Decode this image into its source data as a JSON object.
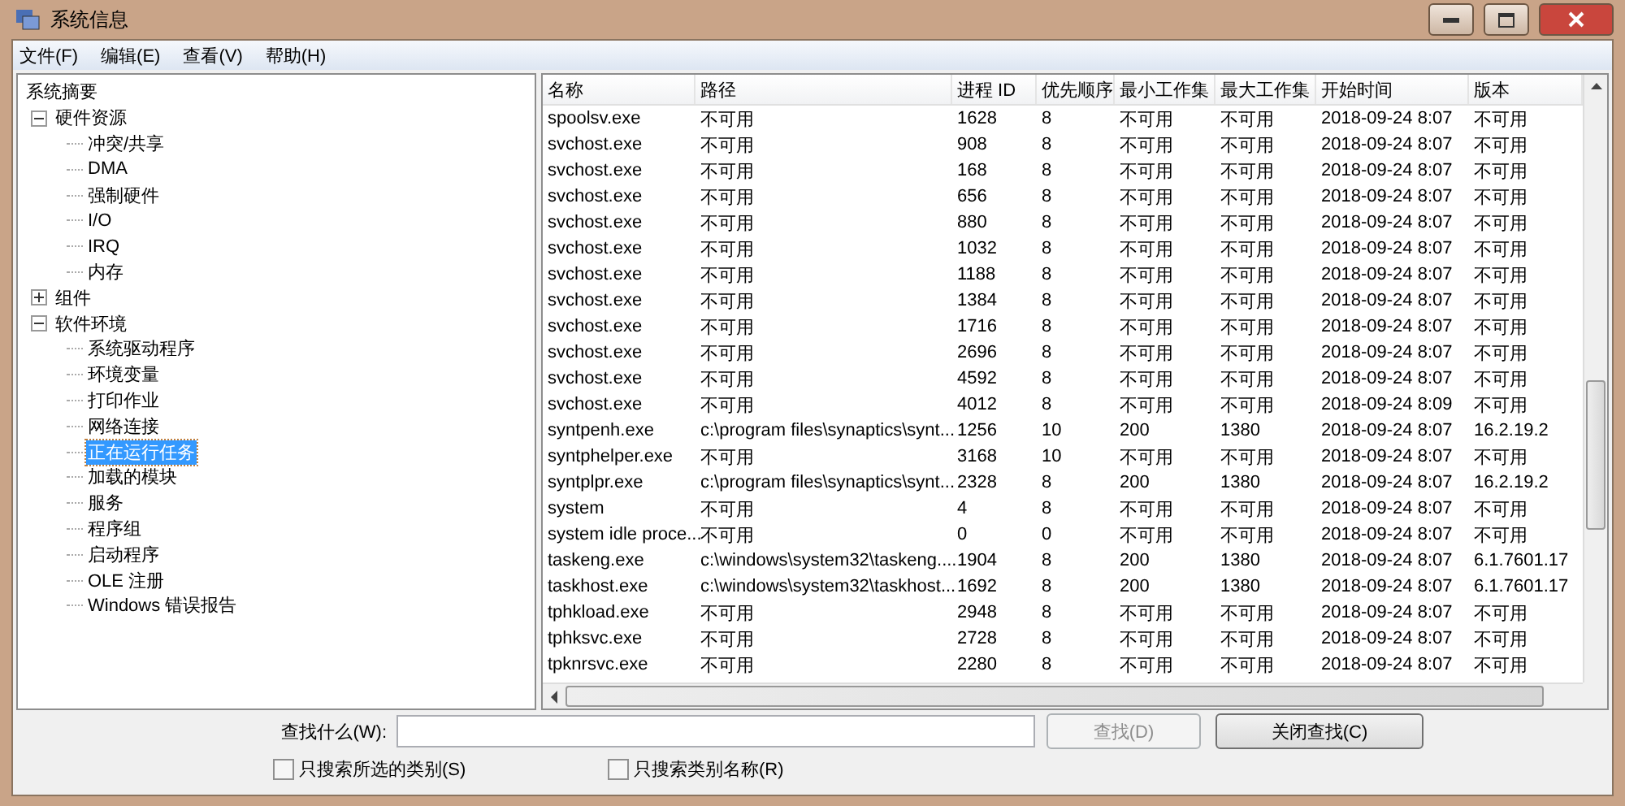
{
  "window": {
    "title": "系统信息"
  },
  "menu": [
    "文件(F)",
    "编辑(E)",
    "查看(V)",
    "帮助(H)"
  ],
  "tree": [
    {
      "label": "系统摘要",
      "selected": false,
      "children": [
        {
          "label": "硬件资源",
          "selected": false,
          "expanded": true,
          "children": [
            {
              "label": "冲突/共享",
              "selected": false
            },
            {
              "label": "DMA",
              "selected": false
            },
            {
              "label": "强制硬件",
              "selected": false
            },
            {
              "label": "I/O",
              "selected": false
            },
            {
              "label": "IRQ",
              "selected": false
            },
            {
              "label": "内存",
              "selected": false
            }
          ]
        },
        {
          "label": "组件",
          "selected": false,
          "expanded": false
        },
        {
          "label": "软件环境",
          "selected": false,
          "expanded": true,
          "children": [
            {
              "label": "系统驱动程序",
              "selected": false
            },
            {
              "label": "环境变量",
              "selected": false
            },
            {
              "label": "打印作业",
              "selected": false
            },
            {
              "label": "网络连接",
              "selected": false
            },
            {
              "label": "正在运行任务",
              "selected": true
            },
            {
              "label": "加载的模块",
              "selected": false
            },
            {
              "label": "服务",
              "selected": false
            },
            {
              "label": "程序组",
              "selected": false
            },
            {
              "label": "启动程序",
              "selected": false
            },
            {
              "label": "OLE 注册",
              "selected": false
            },
            {
              "label": "Windows 错误报告",
              "selected": false
            }
          ]
        }
      ]
    }
  ],
  "table": {
    "columns": [
      "名称",
      "路径",
      "进程 ID",
      "优先顺序",
      "最小工作集",
      "最大工作集",
      "开始时间",
      "版本"
    ],
    "rows": [
      [
        "spoolsv.exe",
        "不可用",
        "1628",
        "8",
        "不可用",
        "不可用",
        "2018-09-24 8:07",
        "不可用"
      ],
      [
        "svchost.exe",
        "不可用",
        "908",
        "8",
        "不可用",
        "不可用",
        "2018-09-24 8:07",
        "不可用"
      ],
      [
        "svchost.exe",
        "不可用",
        "168",
        "8",
        "不可用",
        "不可用",
        "2018-09-24 8:07",
        "不可用"
      ],
      [
        "svchost.exe",
        "不可用",
        "656",
        "8",
        "不可用",
        "不可用",
        "2018-09-24 8:07",
        "不可用"
      ],
      [
        "svchost.exe",
        "不可用",
        "880",
        "8",
        "不可用",
        "不可用",
        "2018-09-24 8:07",
        "不可用"
      ],
      [
        "svchost.exe",
        "不可用",
        "1032",
        "8",
        "不可用",
        "不可用",
        "2018-09-24 8:07",
        "不可用"
      ],
      [
        "svchost.exe",
        "不可用",
        "1188",
        "8",
        "不可用",
        "不可用",
        "2018-09-24 8:07",
        "不可用"
      ],
      [
        "svchost.exe",
        "不可用",
        "1384",
        "8",
        "不可用",
        "不可用",
        "2018-09-24 8:07",
        "不可用"
      ],
      [
        "svchost.exe",
        "不可用",
        "1716",
        "8",
        "不可用",
        "不可用",
        "2018-09-24 8:07",
        "不可用"
      ],
      [
        "svchost.exe",
        "不可用",
        "2696",
        "8",
        "不可用",
        "不可用",
        "2018-09-24 8:07",
        "不可用"
      ],
      [
        "svchost.exe",
        "不可用",
        "4592",
        "8",
        "不可用",
        "不可用",
        "2018-09-24 8:07",
        "不可用"
      ],
      [
        "svchost.exe",
        "不可用",
        "4012",
        "8",
        "不可用",
        "不可用",
        "2018-09-24 8:09",
        "不可用"
      ],
      [
        "syntpenh.exe",
        "c:\\program files\\synaptics\\synt...",
        "1256",
        "10",
        "200",
        "1380",
        "2018-09-24 8:07",
        "16.2.19.2"
      ],
      [
        "syntphelper.exe",
        "不可用",
        "3168",
        "10",
        "不可用",
        "不可用",
        "2018-09-24 8:07",
        "不可用"
      ],
      [
        "syntplpr.exe",
        "c:\\program files\\synaptics\\synt...",
        "2328",
        "8",
        "200",
        "1380",
        "2018-09-24 8:07",
        "16.2.19.2"
      ],
      [
        "system",
        "不可用",
        "4",
        "8",
        "不可用",
        "不可用",
        "2018-09-24 8:07",
        "不可用"
      ],
      [
        "system idle proce...",
        "不可用",
        "0",
        "0",
        "不可用",
        "不可用",
        "2018-09-24 8:07",
        "不可用"
      ],
      [
        "taskeng.exe",
        "c:\\windows\\system32\\taskeng....",
        "1904",
        "8",
        "200",
        "1380",
        "2018-09-24 8:07",
        "6.1.7601.17"
      ],
      [
        "taskhost.exe",
        "c:\\windows\\system32\\taskhost...",
        "1692",
        "8",
        "200",
        "1380",
        "2018-09-24 8:07",
        "6.1.7601.17"
      ],
      [
        "tphkload.exe",
        "不可用",
        "2948",
        "8",
        "不可用",
        "不可用",
        "2018-09-24 8:07",
        "不可用"
      ],
      [
        "tphksvc.exe",
        "不可用",
        "2728",
        "8",
        "不可用",
        "不可用",
        "2018-09-24 8:07",
        "不可用"
      ],
      [
        "tpknrsvc.exe",
        "不可用",
        "2280",
        "8",
        "不可用",
        "不可用",
        "2018-09-24 8:07",
        "不可用"
      ]
    ]
  },
  "find": {
    "label": "查找什么(W):",
    "buttons": [
      {
        "label": "查找(D)",
        "disabled": true
      },
      {
        "label": "关闭查找(C)",
        "disabled": false
      }
    ],
    "options": [
      {
        "label": "只搜索所选的类别(S)",
        "checked": false
      },
      {
        "label": "只搜索类别名称(R)",
        "checked": false
      }
    ]
  }
}
